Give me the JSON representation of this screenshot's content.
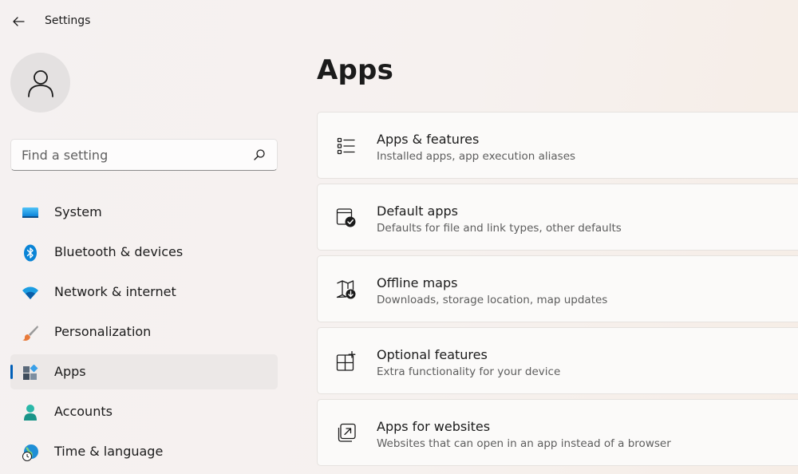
{
  "window": {
    "title": "Settings"
  },
  "search": {
    "placeholder": "Find a setting"
  },
  "sidebar": {
    "items": [
      {
        "label": "System",
        "icon": "system-icon"
      },
      {
        "label": "Bluetooth & devices",
        "icon": "bluetooth-icon"
      },
      {
        "label": "Network & internet",
        "icon": "wifi-icon"
      },
      {
        "label": "Personalization",
        "icon": "brush-icon"
      },
      {
        "label": "Apps",
        "icon": "apps-icon",
        "selected": true
      },
      {
        "label": "Accounts",
        "icon": "accounts-icon"
      },
      {
        "label": "Time & language",
        "icon": "time-language-icon"
      }
    ]
  },
  "main": {
    "title": "Apps",
    "cards": [
      {
        "title": "Apps & features",
        "description": "Installed apps, app execution aliases",
        "icon": "list-icon"
      },
      {
        "title": "Default apps",
        "description": "Defaults for file and link types, other defaults",
        "icon": "default-apps-icon"
      },
      {
        "title": "Offline maps",
        "description": "Downloads, storage location, map updates",
        "icon": "map-download-icon"
      },
      {
        "title": "Optional features",
        "description": "Extra functionality for your device",
        "icon": "optional-features-icon"
      },
      {
        "title": "Apps for websites",
        "description": "Websites that can open in an app instead of a browser",
        "icon": "open-in-app-icon"
      }
    ]
  },
  "colors": {
    "accent": "#005fb8",
    "selected_bg": "#ece8e7",
    "card_bg": "#fbfaf9"
  }
}
